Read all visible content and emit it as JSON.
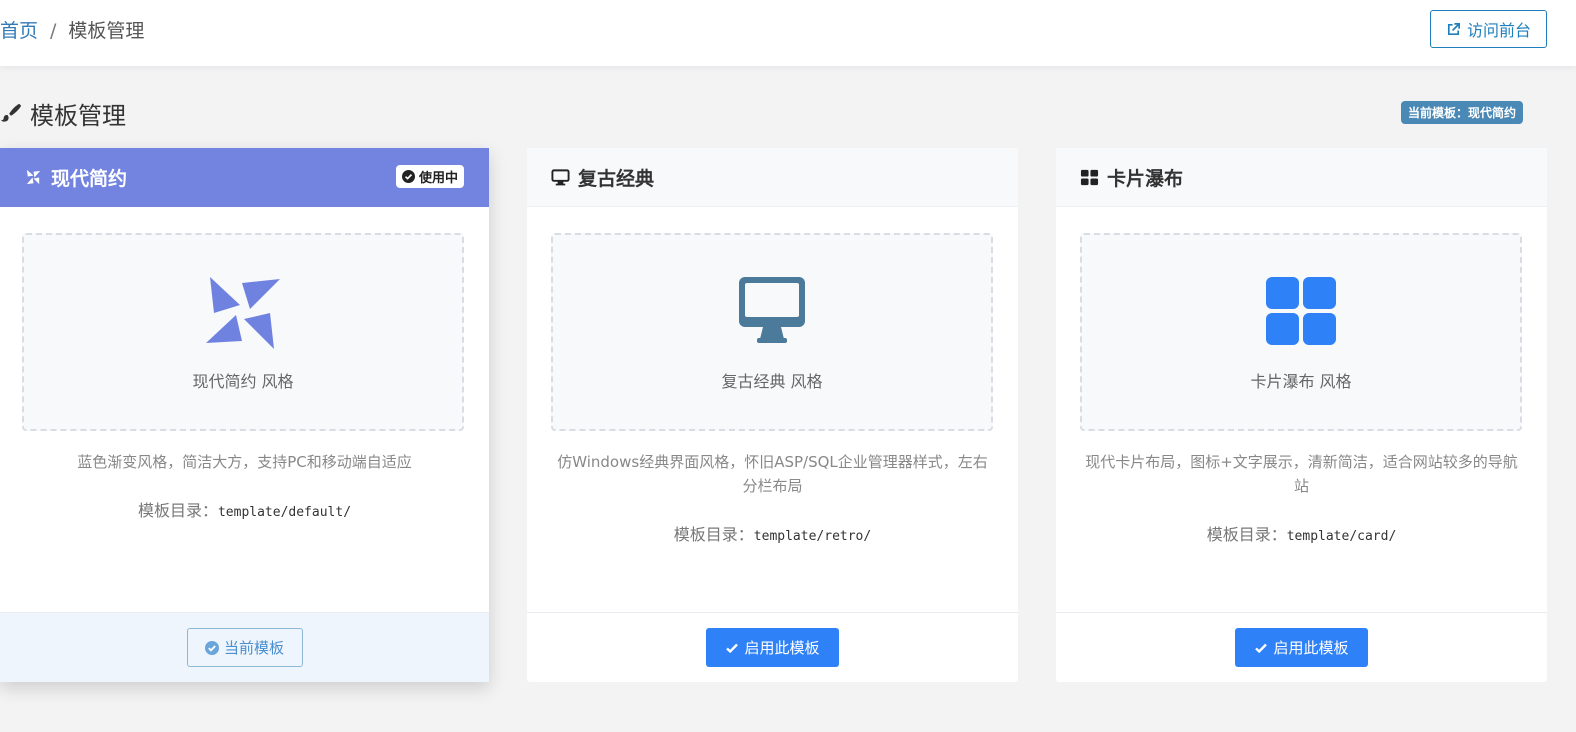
{
  "header": {
    "breadcrumb": {
      "home": "首页",
      "separator": "/",
      "current": "模板管理"
    },
    "visit_button": "访问前台"
  },
  "page": {
    "title": "模板管理",
    "current_template_badge": "当前模板：现代简约"
  },
  "colors": {
    "accent": "#7283e0",
    "primary_button": "#2f81f7",
    "monitor_icon": "#4b7a9a",
    "cards_icon": "#2f81f7"
  },
  "templates": [
    {
      "name": "现代简约",
      "icon": "pinwheel-icon",
      "badge": "使用中",
      "preview_label": "现代简约 风格",
      "description": "蓝色渐变风格，简洁大方，支持PC和移动端自适应",
      "dir_label": "模板目录：",
      "dir_path": "template/default/",
      "button": "当前模板",
      "active": true
    },
    {
      "name": "复古经典",
      "icon": "monitor-icon",
      "preview_label": "复古经典 风格",
      "description": "仿Windows经典界面风格，怀旧ASP/SQL企业管理器样式，左右分栏布局",
      "dir_label": "模板目录：",
      "dir_path": "template/retro/",
      "button": "启用此模板",
      "active": false
    },
    {
      "name": "卡片瀑布",
      "icon": "grid-icon",
      "preview_label": "卡片瀑布 风格",
      "description": "现代卡片布局，图标+文字展示，清新简洁，适合网站较多的导航站",
      "dir_label": "模板目录：",
      "dir_path": "template/card/",
      "button": "启用此模板",
      "active": false
    }
  ]
}
